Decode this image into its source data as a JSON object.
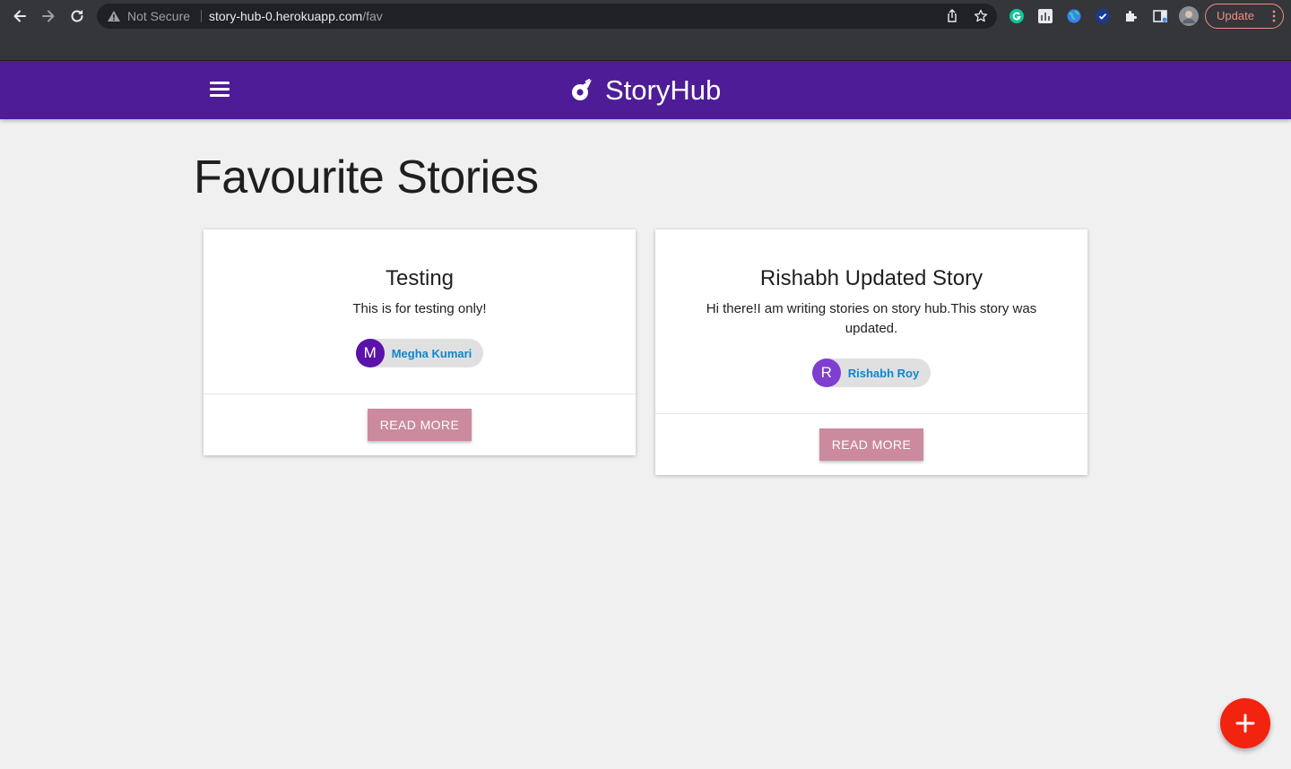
{
  "browser": {
    "security_label": "Not Secure",
    "url_host": "story-hub-0.herokuapp.com",
    "url_path": "/fav",
    "update_label": "Update",
    "icons": [
      "back-icon",
      "forward-icon",
      "reload-icon",
      "warning-icon",
      "share-icon",
      "star-icon",
      "grammarly-icon",
      "analytics-extension-icon",
      "earth-extension-icon",
      "check-extension-icon",
      "puzzle-icon",
      "sidebar-icon",
      "profile-avatar",
      "more-vert-icon"
    ]
  },
  "appbar": {
    "brand": "StoryHub",
    "color": "#4e1c96",
    "icons": [
      "menu-icon",
      "storyhub-logo-icon"
    ]
  },
  "page": {
    "title": "Favourite Stories"
  },
  "stories": [
    {
      "title": "Testing",
      "description": "This is for testing only!",
      "author_initial": "M",
      "author_name": "Megha Kumari",
      "avatar_color": "#5a12a8",
      "action": "READ MORE"
    },
    {
      "title": "Rishabh Updated Story",
      "description": "Hi there!I am writing stories on story hub.This story was updated.",
      "author_initial": "R",
      "author_name": "Rishabh Roy",
      "avatar_color": "#7e3fd0",
      "action": "READ MORE"
    }
  ],
  "fab": {
    "icon": "plus-icon",
    "color": "#f2230f"
  },
  "colors": {
    "button": "#cb8a9e",
    "author_link": "#0f86d0",
    "background": "#f0f0f0"
  }
}
